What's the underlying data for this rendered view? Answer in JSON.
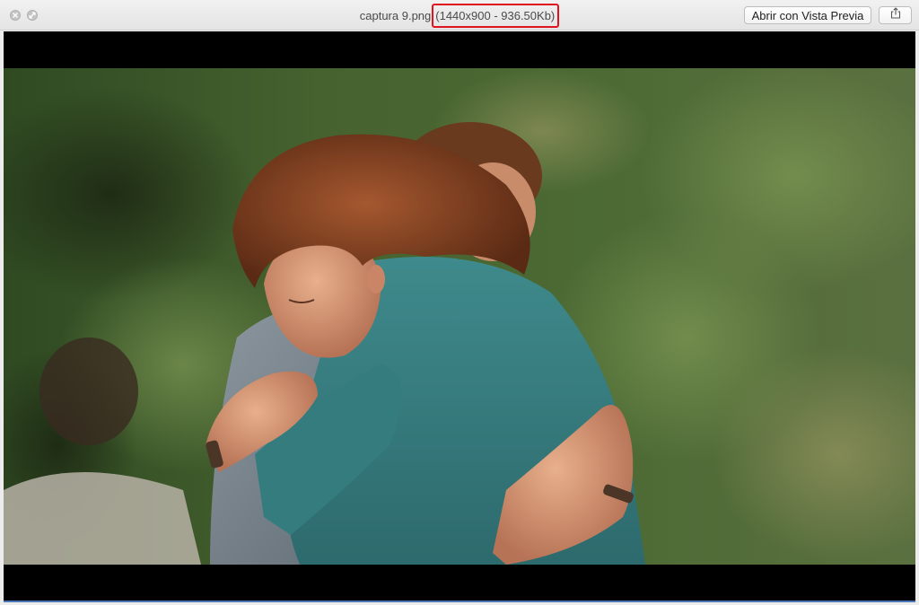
{
  "window": {
    "file_name": "captura 9.png",
    "file_meta": "(1440x900 - 936.50Kb)",
    "open_button_label": "Abrir con Vista Previa"
  },
  "icons": {
    "close": "close-icon",
    "fullscreen": "fullscreen-icon",
    "share": "share-icon"
  },
  "colors": {
    "highlight_border": "#e0141e",
    "letterbox": "#000000"
  }
}
